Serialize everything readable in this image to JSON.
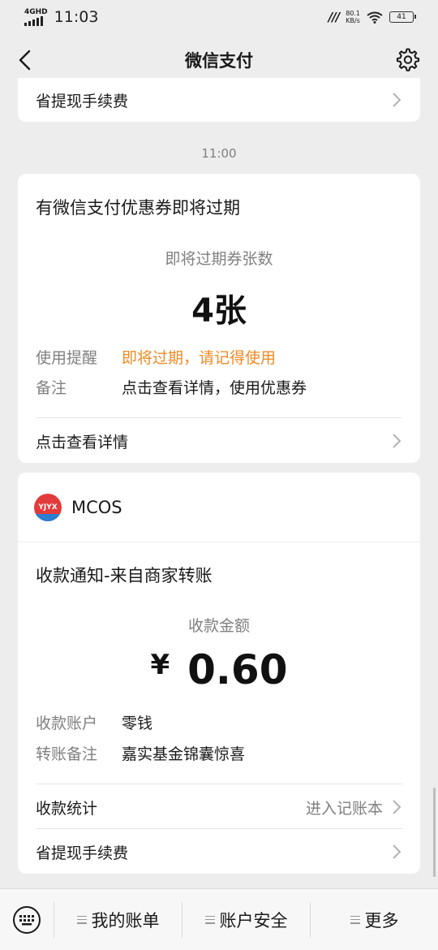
{
  "status_bar": {
    "network": "4GHD",
    "time": "11:03",
    "speed_value": "80.1",
    "speed_unit": "KB/s",
    "battery": "41"
  },
  "nav": {
    "title": "微信支付"
  },
  "top_partial_card": {
    "link_label": "省提现手续费"
  },
  "timestamp": "11:00",
  "coupon_card": {
    "title": "有微信支付优惠券即将过期",
    "center_label": "即将过期券张数",
    "value": "4张",
    "rows": [
      {
        "key": "使用提醒",
        "value": "即将过期，请记得使用",
        "value_color": "#f08a24"
      },
      {
        "key": "备注",
        "value": "点击查看详情，使用优惠券"
      }
    ],
    "link_label": "点击查看详情"
  },
  "payment_card": {
    "merchant_logo_text": "YJYX",
    "merchant_name": "MCOS",
    "title": "收款通知-来自商家转账",
    "center_label": "收款金额",
    "currency": "¥",
    "amount": "0.60",
    "rows": [
      {
        "key": "收款账户",
        "value": "零钱"
      },
      {
        "key": "转账备注",
        "value": "嘉实基金锦囊惊喜"
      }
    ],
    "stats_label": "收款统计",
    "stats_action": "进入记账本",
    "fee_label": "省提现手续费"
  },
  "bottom_menu": [
    {
      "label": "我的账单"
    },
    {
      "label": "账户安全"
    },
    {
      "label": "更多"
    }
  ],
  "colors": {
    "background": "#ededed",
    "card": "#ffffff",
    "warning": "#f08a24",
    "secondary_text": "#808080"
  }
}
